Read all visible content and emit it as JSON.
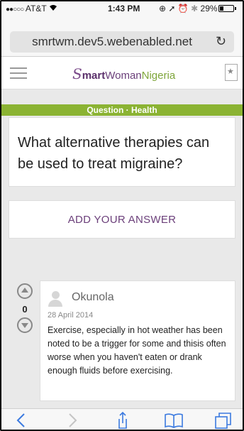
{
  "status_bar": {
    "signal": "●●○○○",
    "carrier": "AT&T",
    "time": "1:43 PM",
    "battery": "29%",
    "battery_level": 0.29
  },
  "browser": {
    "url": "smrtwm.dev5.webenabled.net",
    "reload_icon": "reload-icon"
  },
  "site": {
    "logo_s": "S",
    "logo_smart": "mart",
    "logo_woman": "Woman",
    "logo_nigeria": "Nigeria",
    "menu_icon": "hamburger-icon",
    "bookmark_icon": "bookmark-star-icon"
  },
  "question": {
    "category": "Question · Health",
    "title": "What alternative therapies can be used to treat migraine?"
  },
  "add_answer_label": "ADD YOUR ANSWER",
  "answer": {
    "votes": "0",
    "author": "Okunola",
    "date": "28 April 2014",
    "text": "Exercise, especially in hot weather has been noted to be a trigger for some and thisis often worse when you haven't eaten or drank enough fluids before exercising."
  },
  "colors": {
    "brand_purple": "#6b3f7a",
    "brand_green": "#8bb333",
    "ios_blue": "#3b7ae0"
  }
}
